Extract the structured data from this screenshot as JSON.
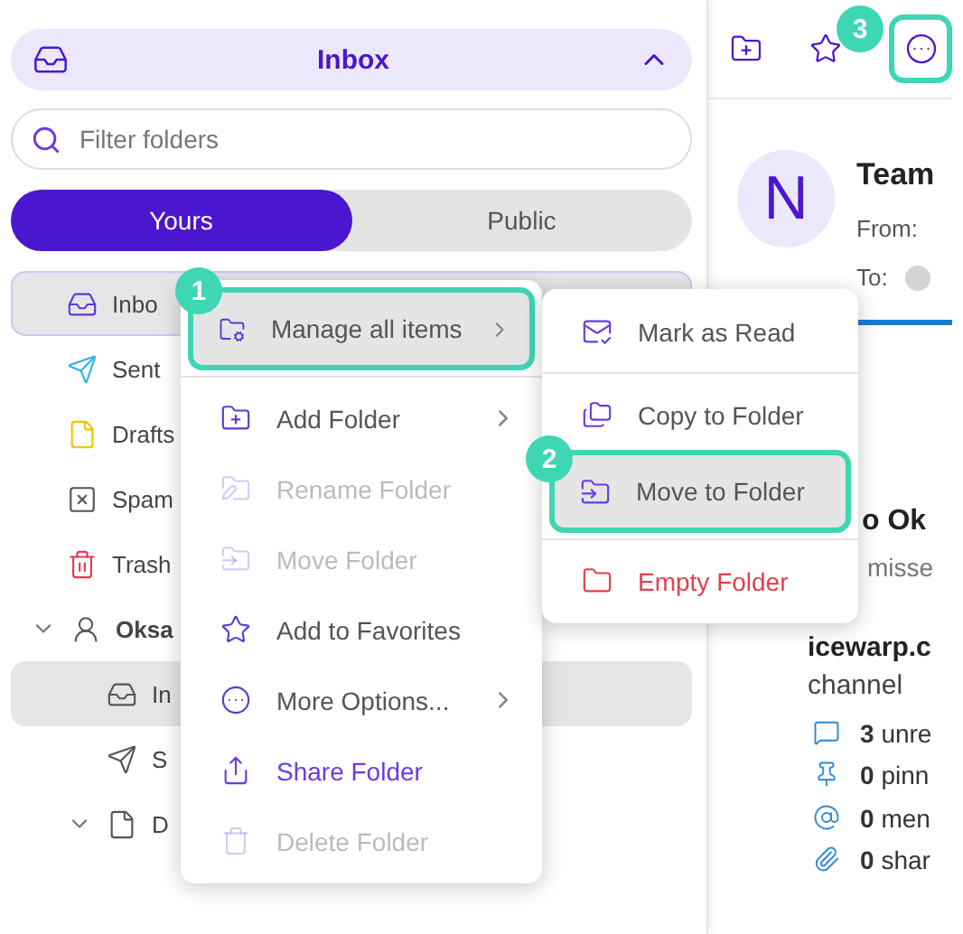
{
  "folder_picker": {
    "title": "Inbox",
    "expanded": true
  },
  "search": {
    "placeholder": "Filter folders"
  },
  "scope_tabs": [
    {
      "label": "Yours",
      "selected": true
    },
    {
      "label": "Public",
      "selected": false
    }
  ],
  "folders": [
    {
      "label": "Inbo",
      "selected": true
    },
    {
      "label": "Sent",
      "selected": false
    },
    {
      "label": "Drafts",
      "selected": false
    },
    {
      "label": "Spam",
      "selected": false
    },
    {
      "label": "Trash",
      "selected": false
    },
    {
      "label": "Oksa",
      "selected": false,
      "expanded": true,
      "children": [
        {
          "label": "In",
          "selected": true
        },
        {
          "label": "S",
          "selected": false
        },
        {
          "label": "D",
          "selected": false,
          "expanded": true
        }
      ]
    }
  ],
  "context_menu": [
    {
      "label": "Manage all items",
      "kind": "normal",
      "disabled": false,
      "highlighted": true,
      "submenu": true
    },
    {
      "label": "Add Folder",
      "kind": "normal",
      "disabled": false,
      "highlighted": false,
      "submenu": true
    },
    {
      "label": "Rename Folder",
      "kind": "normal",
      "disabled": true,
      "highlighted": false,
      "submenu": false
    },
    {
      "label": "Move Folder",
      "kind": "normal",
      "disabled": true,
      "highlighted": false,
      "submenu": false
    },
    {
      "label": "Add to Favorites",
      "kind": "normal",
      "disabled": false,
      "highlighted": false,
      "submenu": false
    },
    {
      "label": "More Options...",
      "kind": "normal",
      "disabled": false,
      "highlighted": false,
      "submenu": true
    },
    {
      "label": "Share Folder",
      "kind": "accent",
      "disabled": false,
      "highlighted": false,
      "submenu": false
    },
    {
      "label": "Delete Folder",
      "kind": "normal",
      "disabled": true,
      "highlighted": false,
      "submenu": false
    }
  ],
  "submenu": [
    {
      "label": "Mark as Read",
      "kind": "normal",
      "highlighted": false
    },
    {
      "label": "Copy to Folder",
      "kind": "normal",
      "highlighted": false
    },
    {
      "label": "Move to Folder",
      "kind": "normal",
      "highlighted": true
    },
    {
      "label": "Empty Folder",
      "kind": "danger",
      "highlighted": false
    }
  ],
  "callouts": [
    "1",
    "2",
    "3"
  ],
  "message": {
    "avatar": "N",
    "sender": "Team",
    "from_label": "From:",
    "to_label": "To:",
    "subject": "o Ok",
    "snippet": "misse",
    "channel_name": "icewarp.c",
    "channel_label": "channel",
    "stats": [
      {
        "count": "3",
        "label": "unre"
      },
      {
        "count": "0",
        "label": "pinn"
      },
      {
        "count": "0",
        "label": "men"
      },
      {
        "count": "0",
        "label": "shar"
      }
    ]
  }
}
